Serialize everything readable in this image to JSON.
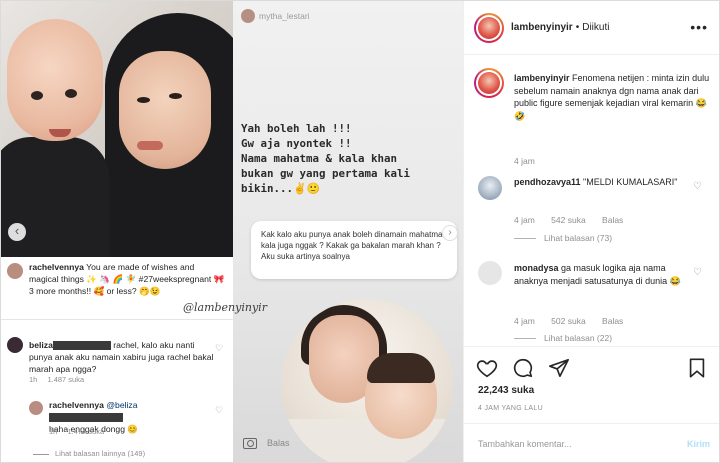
{
  "left_panel": {
    "watermark": "@lambenyinyir",
    "comments": [
      {
        "user": "rachelvennya",
        "text": "You are made of wishes and magical things ✨ 🦄 🌈 🧚 #27weekspregnant 🎀 3 more months!! 🥰 or less? 🤭😉"
      },
      {
        "user": "beliza",
        "text": "rachel, kalo aku nanti punya anak aku namain xabiru juga rachel bakal marah apa ngga?",
        "time": "1h",
        "likes": "1.487 suka"
      },
      {
        "user": "rachelvennya",
        "mention": "@beliza",
        "text": "haha enggak dongg 😊",
        "time": "1h",
        "likes": "1.474 suka"
      }
    ],
    "view_more": "Lihat balasan lainnya (149)"
  },
  "story": {
    "username": "mytha_lestari",
    "lines": [
      "Yah boleh lah !!!",
      "Gw aja nyontek !!",
      "Nama mahatma & kala khan",
      "bukan gw yang pertama kali",
      "bikin...✌️🙂"
    ],
    "question": "Kak kalo aku punya anak boleh dinamain mahatma kala juga nggak ? Kakak ga bakalan marah khan ? Aku suka artinya soalnya",
    "reply_label": "Balas"
  },
  "right_panel": {
    "header": {
      "username": "lambenyinyir",
      "separator": "•",
      "follow_status": "Diikuti",
      "more": "•••"
    },
    "caption": {
      "username": "lambenyinyir",
      "text": "Fenomena netijen : minta izin dulu sebelum namain anaknya dgn nama anak dari public figure semenjak kejadian viral kemarin 😂🤣",
      "time": "4 jam"
    },
    "comments": [
      {
        "username": "pendhozavya11",
        "text": "\"MELDI KUMALASARI\"",
        "time": "4 jam",
        "likes": "542 suka",
        "reply": "Balas",
        "view_replies": "Lihat balasan (73)"
      },
      {
        "username": "monadysa",
        "text": "ga masuk logika aja nama anaknya menjadi satusatunya di dunia 😂",
        "time": "4 jam",
        "likes": "502 suka",
        "reply": "Balas",
        "view_replies": "Lihat balasan (22)"
      }
    ],
    "likes_count": "22,243 suka",
    "posted_time": "4 JAM YANG LALU",
    "comment_placeholder": "Tambahkan komentar...",
    "post_button": "Kirim"
  },
  "colors": {
    "text": "#262626",
    "muted": "#8e8e8e",
    "border": "#efefef",
    "post_button_disabled": "#b2dffc"
  }
}
